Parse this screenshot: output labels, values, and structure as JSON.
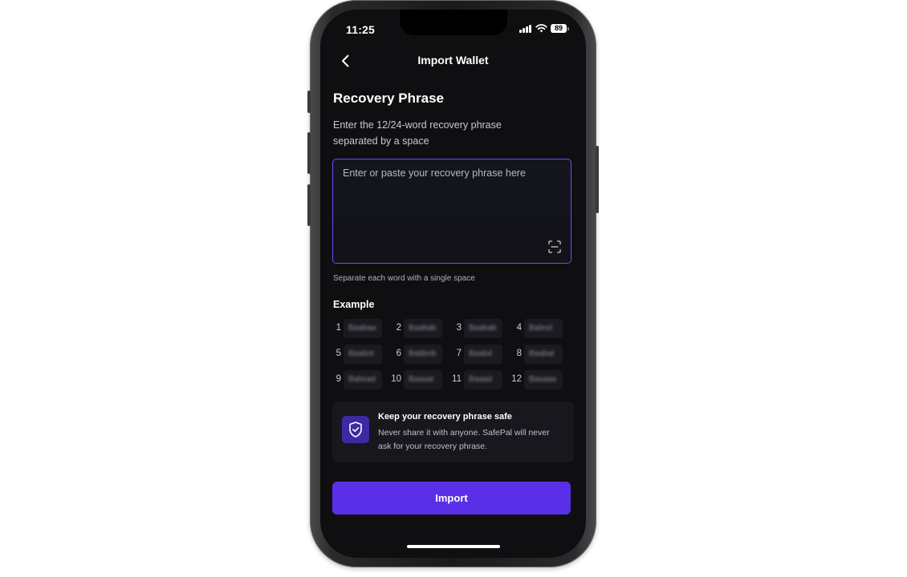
{
  "status_bar": {
    "time": "11:25",
    "battery": "89"
  },
  "header": {
    "title": "Import Wallet",
    "back_icon": "chevron-left-icon"
  },
  "main": {
    "heading": "Recovery Phrase",
    "subtitle": "Enter the 12/24-word recovery phrase separated by a space",
    "phrase_input": {
      "placeholder": "Enter or paste your recovery phrase here",
      "value": ""
    },
    "scan_icon": "scan-icon",
    "hint": "Separate each word with a single space",
    "example_label": "Example",
    "example_words": [
      {
        "n": "1",
        "w": "Baabaa"
      },
      {
        "n": "2",
        "w": "Baabab"
      },
      {
        "n": "3",
        "w": "Baabab"
      },
      {
        "n": "4",
        "w": "Babnd"
      },
      {
        "n": "5",
        "w": "Baabnt"
      },
      {
        "n": "6",
        "w": "Babbnb"
      },
      {
        "n": "7",
        "w": "Baabd"
      },
      {
        "n": "8",
        "w": "Baabat"
      },
      {
        "n": "9",
        "w": "Babsad"
      },
      {
        "n": "10",
        "w": "Baasat"
      },
      {
        "n": "11",
        "w": "Baaad"
      },
      {
        "n": "12",
        "w": "Basaaa"
      }
    ]
  },
  "safety": {
    "icon": "shield-check-icon",
    "title": "Keep your recovery phrase safe",
    "body": "Never share it with anyone. SafePal will never ask for your recovery phrase."
  },
  "footer": {
    "import_label": "Import"
  },
  "colors": {
    "accent": "#5a2fe8",
    "border": "#6a4cf0",
    "background": "#0f0f12"
  }
}
